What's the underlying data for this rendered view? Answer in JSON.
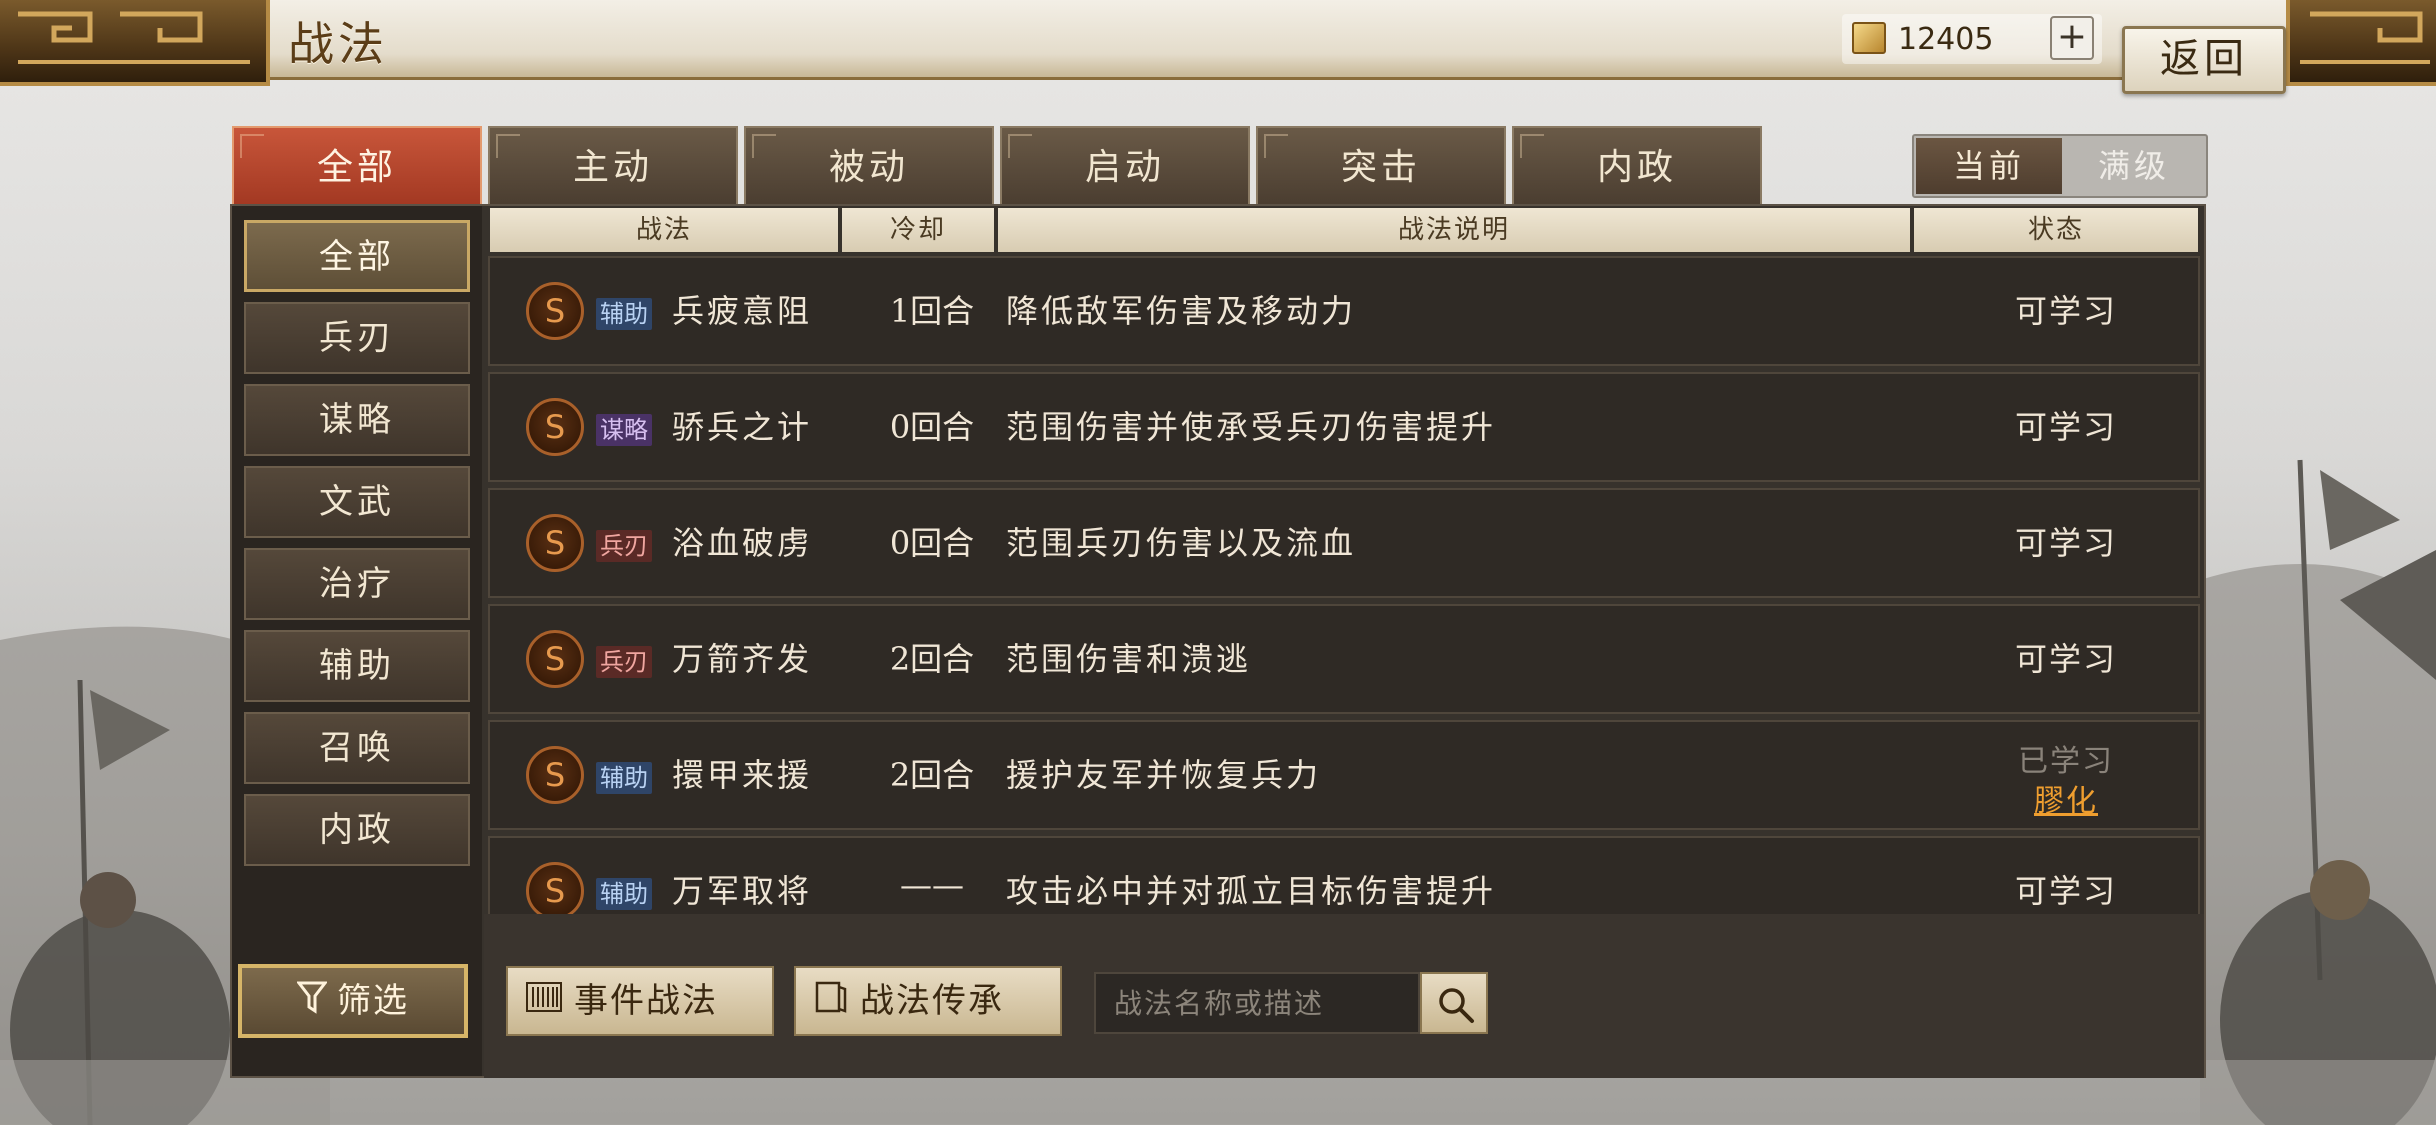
{
  "header": {
    "title": "战法",
    "currency_value": "12405",
    "plus_label": "+",
    "back_label": "返回"
  },
  "tabs": [
    {
      "label": "全部",
      "active": true
    },
    {
      "label": "主动",
      "active": false
    },
    {
      "label": "被动",
      "active": false
    },
    {
      "label": "启动",
      "active": false
    },
    {
      "label": "突击",
      "active": false
    },
    {
      "label": "内政",
      "active": false
    }
  ],
  "level_toggle": {
    "current": "当前",
    "max": "满级"
  },
  "sidebar": {
    "items": [
      {
        "label": "全部",
        "active": true
      },
      {
        "label": "兵刃",
        "active": false
      },
      {
        "label": "谋略",
        "active": false
      },
      {
        "label": "文武",
        "active": false
      },
      {
        "label": "治疗",
        "active": false
      },
      {
        "label": "辅助",
        "active": false
      },
      {
        "label": "召唤",
        "active": false
      },
      {
        "label": "内政",
        "active": false
      }
    ],
    "filter_label": "筛选"
  },
  "table": {
    "headers": {
      "skill": "战法",
      "cooldown": "冷却",
      "description": "战法说明",
      "status": "状态"
    },
    "rows": [
      {
        "grade": "S",
        "type": "辅助",
        "type_class": "assist",
        "name": "兵疲意阻",
        "cooldown": "1回合",
        "description": "降低敌军伤害及移动力",
        "status": "可学习",
        "status_sub": ""
      },
      {
        "grade": "S",
        "type": "谋略",
        "type_class": "strategy",
        "name": "骄兵之计",
        "cooldown": "0回合",
        "description": "范围伤害并使承受兵刃伤害提升",
        "status": "可学习",
        "status_sub": ""
      },
      {
        "grade": "S",
        "type": "兵刃",
        "type_class": "weapon",
        "name": "浴血破虏",
        "cooldown": "0回合",
        "description": "范围兵刃伤害以及流血",
        "status": "可学习",
        "status_sub": ""
      },
      {
        "grade": "S",
        "type": "兵刃",
        "type_class": "weapon",
        "name": "万箭齐发",
        "cooldown": "2回合",
        "description": "范围伤害和溃逃",
        "status": "可学习",
        "status_sub": ""
      },
      {
        "grade": "S",
        "type": "辅助",
        "type_class": "assist",
        "name": "擐甲来援",
        "cooldown": "2回合",
        "description": "援护友军并恢复兵力",
        "status": "已学习",
        "status_sub": "膠化"
      },
      {
        "grade": "S",
        "type": "辅助",
        "type_class": "assist",
        "name": "万军取将",
        "cooldown": "——",
        "description": "攻击必中并对孤立目标伤害提升",
        "status": "可学习",
        "status_sub": ""
      }
    ]
  },
  "bottom": {
    "event_label": "事件战法",
    "inherit_label": "战法传承",
    "search_placeholder": "战法名称或描述"
  },
  "colors": {
    "active_tab": "#b8452c",
    "assist_tag": "#2f4568",
    "strategy_tag": "#4a3266",
    "weapon_tag": "#5a2a26",
    "status_highlight": "#ef9e2f"
  }
}
